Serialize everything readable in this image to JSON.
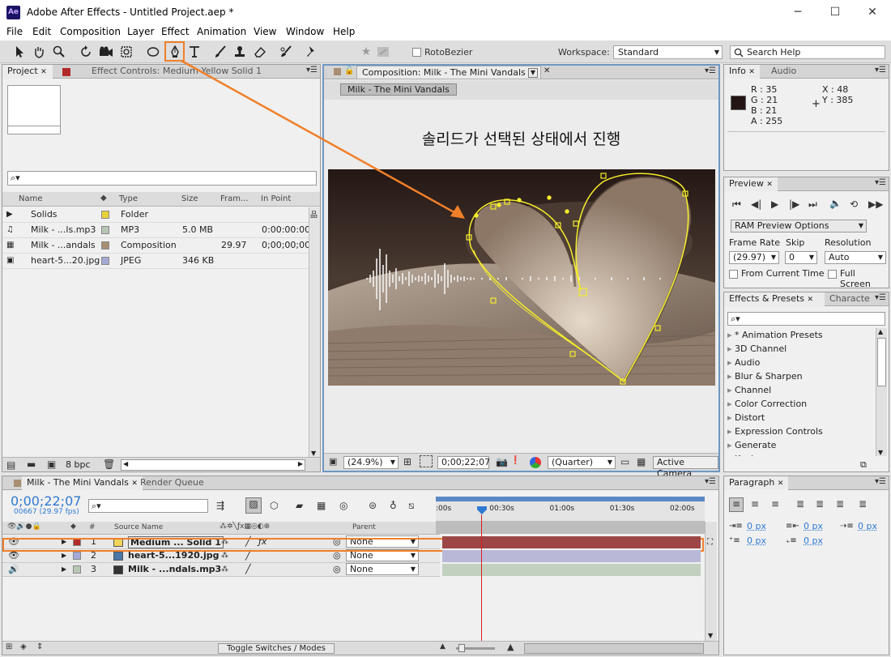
{
  "window": {
    "title": "Adobe After Effects - Untitled Project.aep *",
    "app_icon": "Ae",
    "minimize": "─",
    "maximize": "☐",
    "close": "✕"
  },
  "menu": [
    "File",
    "Edit",
    "Composition",
    "Layer",
    "Effect",
    "Animation",
    "View",
    "Window",
    "Help"
  ],
  "toolbar": {
    "rotobezier_label": "RotoBezier",
    "workspace_label": "Workspace:",
    "workspace_value": "Standard",
    "search_help_placeholder": "Search Help"
  },
  "project_panel": {
    "tab_project": "Project",
    "tab_effect_controls": "Effect Controls: Medium Yellow Solid 1",
    "search_value": "",
    "columns": [
      "Name",
      "Type",
      "Size",
      "Fram...",
      "In Point"
    ],
    "items": [
      {
        "name": "Solids",
        "type": "Folder",
        "size": "",
        "fps": "",
        "in_point": "",
        "color": "#e8d33a",
        "icon": "folder-icon"
      },
      {
        "name": "Milk - ...ls.mp3",
        "type": "MP3",
        "size": "5.0 MB",
        "fps": "",
        "in_point": "0:00:00:00",
        "color": "#b8c7b4",
        "icon": "audio-file-icon"
      },
      {
        "name": "Milk - ...andals",
        "type": "Composition",
        "size": "",
        "fps": "29.97",
        "in_point": "0;00;00;00",
        "color": "#a88f73",
        "icon": "composition-icon"
      },
      {
        "name": "heart-5...20.jpg",
        "type": "JPEG",
        "size": "346 KB",
        "fps": "",
        "in_point": "",
        "color": "#a4a9d6",
        "icon": "image-file-icon"
      }
    ],
    "bpc": "8 bpc"
  },
  "composition_panel": {
    "tab": "Composition: Milk - The Mini Vandals",
    "breadcrumb": "Milk - The Mini Vandals",
    "annotation": "솔리드가 선택된 상태에서 진행",
    "zoom": "(24.9%)",
    "timecode": "0;00;22;07",
    "resolution": "(Quarter)",
    "camera": "Active Camera"
  },
  "info_panel": {
    "tab_info": "Info",
    "tab_audio": "Audio",
    "r": "R : 35",
    "g": "G : 21",
    "b": "B : 21",
    "a": "A : 255",
    "x": "X : 48",
    "y": "Y : 385",
    "swatch": "#231515"
  },
  "preview_panel": {
    "tab": "Preview",
    "ram_options": "RAM Preview Options",
    "frame_rate_label": "Frame Rate",
    "skip_label": "Skip",
    "resolution_label": "Resolution",
    "frame_rate": "(29.97)",
    "skip": "0",
    "resolution": "Auto",
    "from_current": "From Current Time",
    "full_screen": "Full Screen"
  },
  "effects_panel": {
    "tab_effects": "Effects & Presets",
    "tab_character": "Characte",
    "items": [
      "* Animation Presets",
      "3D Channel",
      "Audio",
      "Blur & Sharpen",
      "Channel",
      "Color Correction",
      "Distort",
      "Expression Controls",
      "Generate",
      "Keying"
    ]
  },
  "timeline": {
    "tab": "Milk - The Mini Vandals",
    "tab_render": "Render Queue",
    "timecode": "0;00;22;07",
    "frame_info": "00667 (29.97 fps)",
    "col_source": "Source Name",
    "col_parent": "Parent",
    "time_ticks": [
      ":00s",
      "00:30s",
      "01:00s",
      "01:30s",
      "02:00s"
    ],
    "layers": [
      {
        "num": "1",
        "name": "Medium ... Solid 1",
        "parent": "None",
        "label_color": "#b22a2a",
        "icon_color": "#f0d35a",
        "bar_color": "#9c4646"
      },
      {
        "num": "2",
        "name": "heart-5...1920.jpg",
        "parent": "None",
        "label_color": "#a4a9d6",
        "icon_color": "#4a77a8",
        "bar_color": "#b9b9d7"
      },
      {
        "num": "3",
        "name": "Milk - ...ndals.mp3",
        "parent": "None",
        "label_color": "#b8c7b4",
        "icon_color": "#333333",
        "bar_color": "#c2d0c0"
      }
    ],
    "toggle_label": "Toggle Switches / Modes",
    "playhead_time_sec": 22.2
  },
  "paragraph_panel": {
    "tab": "Paragraph",
    "values": [
      "0 px",
      "0 px",
      "0 px",
      "0 px",
      "0 px"
    ]
  }
}
